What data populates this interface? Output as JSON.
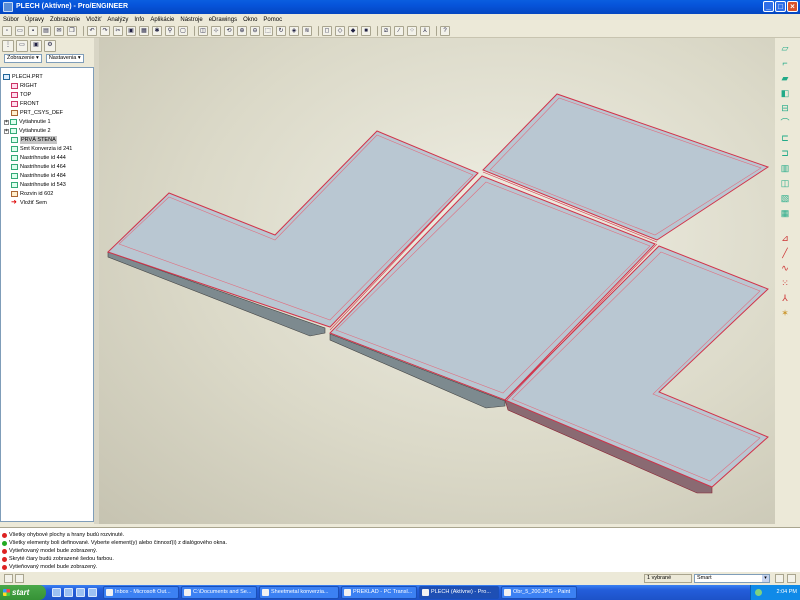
{
  "window": {
    "title": "PLECH (Aktívne) - Pro/ENGINEER",
    "buttons": [
      "_",
      "□",
      "×"
    ]
  },
  "menu": [
    "Súbor",
    "Úpravy",
    "Zobrazenie",
    "Vložiť",
    "Analýzy",
    "Info",
    "Aplikácie",
    "Nástroje",
    "eDrawings",
    "Okno",
    "Pomoc"
  ],
  "model_tree": {
    "dropdowns": [
      "Zobrazenie ▾",
      "Nastavenia ▾"
    ],
    "items": [
      {
        "label": "PLECH.PRT",
        "icon": "part-icon"
      },
      {
        "label": "RIGHT",
        "icon": "datum-plane-icon"
      },
      {
        "label": "TOP",
        "icon": "datum-plane-icon"
      },
      {
        "label": "FRONT",
        "icon": "datum-plane-icon"
      },
      {
        "label": "PRT_CSYS_DEF",
        "icon": "csys-icon"
      },
      {
        "label": "Vytiahnutie 1",
        "icon": "extrude-icon"
      },
      {
        "label": "Vytiahnutie 2",
        "icon": "extrude-icon"
      },
      {
        "label": "PRVÁ STENA",
        "icon": "wall-icon"
      },
      {
        "label": "Smt Konverzia id 241",
        "icon": "conversion-icon"
      },
      {
        "label": "Nastrihnutie id 444",
        "icon": "rip-icon"
      },
      {
        "label": "Nastrihnutie id 464",
        "icon": "rip-icon"
      },
      {
        "label": "Nastrihnutie id 484",
        "icon": "rip-icon"
      },
      {
        "label": "Nastrihnutie id 543",
        "icon": "rip-icon"
      },
      {
        "label": "Rozvin id 602",
        "icon": "unbend-icon"
      },
      {
        "label": "Vložiť Sem",
        "icon": "insert-here-icon"
      }
    ]
  },
  "messages": [
    {
      "text": "Všetky ohybové plochy a hrany budú rozvinuté.",
      "type": "info"
    },
    {
      "text": "Všetky elementy boli definované. Vyberte element(y) alebo činnosť(i) z dialógového okna.",
      "type": "ok"
    },
    {
      "text": "Vytieňovaný model bude zobrazený.",
      "type": "info"
    },
    {
      "text": "Skryté čiary budú zobrazené šedou farbou.",
      "type": "info"
    },
    {
      "text": "Vytieňovaný model bude zobrazený.",
      "type": "info"
    }
  ],
  "status": {
    "selected": "1 vybrané",
    "filter": "Smart"
  },
  "taskbar": {
    "start": "start",
    "tasks": [
      {
        "label": "Inbox - Microsoft Out..."
      },
      {
        "label": "C:\\Documents and Se..."
      },
      {
        "label": "Sheetmetal konverzia..."
      },
      {
        "label": "PREKLAD - PC Transl..."
      },
      {
        "label": "PLECH (Aktívne) - Pro..."
      },
      {
        "label": "Obr_5_200.JPG - Paint"
      }
    ],
    "clock": "2:04 PM"
  },
  "colors": {
    "titlebar": "#0653d9",
    "viewport_bg": "#dbd9c8",
    "part_face": "#b9c7d2",
    "part_edge": "#d2334a",
    "taskbar": "#245edb"
  }
}
